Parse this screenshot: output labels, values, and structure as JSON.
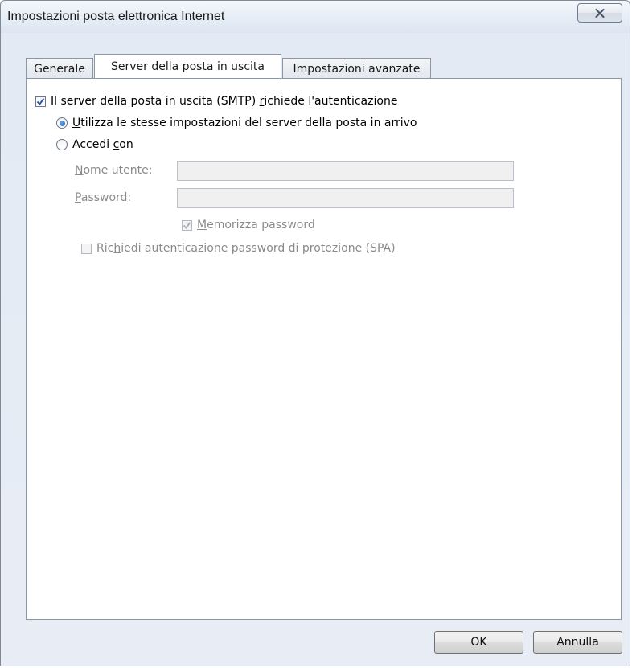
{
  "window": {
    "title": "Impostazioni posta elettronica Internet",
    "close_glyph": "✕"
  },
  "tabs": [
    {
      "label": "Generale",
      "active": false
    },
    {
      "label": "Server della posta in uscita",
      "active": true
    },
    {
      "label": "Impostazioni avanzate",
      "active": false
    }
  ],
  "smtp_auth": {
    "checked": true,
    "label_pre": "Il server della posta in uscita (SMTP) ",
    "label_access": "r",
    "label_post": "ichiede l'autenticazione"
  },
  "radio_same": {
    "selected": true,
    "label_access": "U",
    "label_post": "tilizza le stesse impostazioni del server della posta in arrivo"
  },
  "radio_login": {
    "selected": false,
    "label_pre": "Accedi ",
    "label_access": "c",
    "label_post": "on"
  },
  "username": {
    "label_access": "N",
    "label_post": "ome utente:",
    "value": ""
  },
  "password": {
    "label_access": "P",
    "label_post": "assword:",
    "value": ""
  },
  "remember_password": {
    "checked": true,
    "enabled": false,
    "label_access": "M",
    "label_post": "emorizza password"
  },
  "spa": {
    "checked": false,
    "label_pre": "Ric",
    "label_access": "h",
    "label_post": "iedi autenticazione password di protezione (SPA)"
  },
  "buttons": {
    "ok": "OK",
    "cancel": "Annulla"
  },
  "colors": {
    "check_enabled": "#2b55a8",
    "check_disabled": "#a5adb8",
    "window_bg": "#e8edf5",
    "panel_bg": "#ffffff"
  },
  "icons": {
    "close": "close-icon",
    "check": "checkmark-icon",
    "radio": "radio-dot-icon"
  }
}
